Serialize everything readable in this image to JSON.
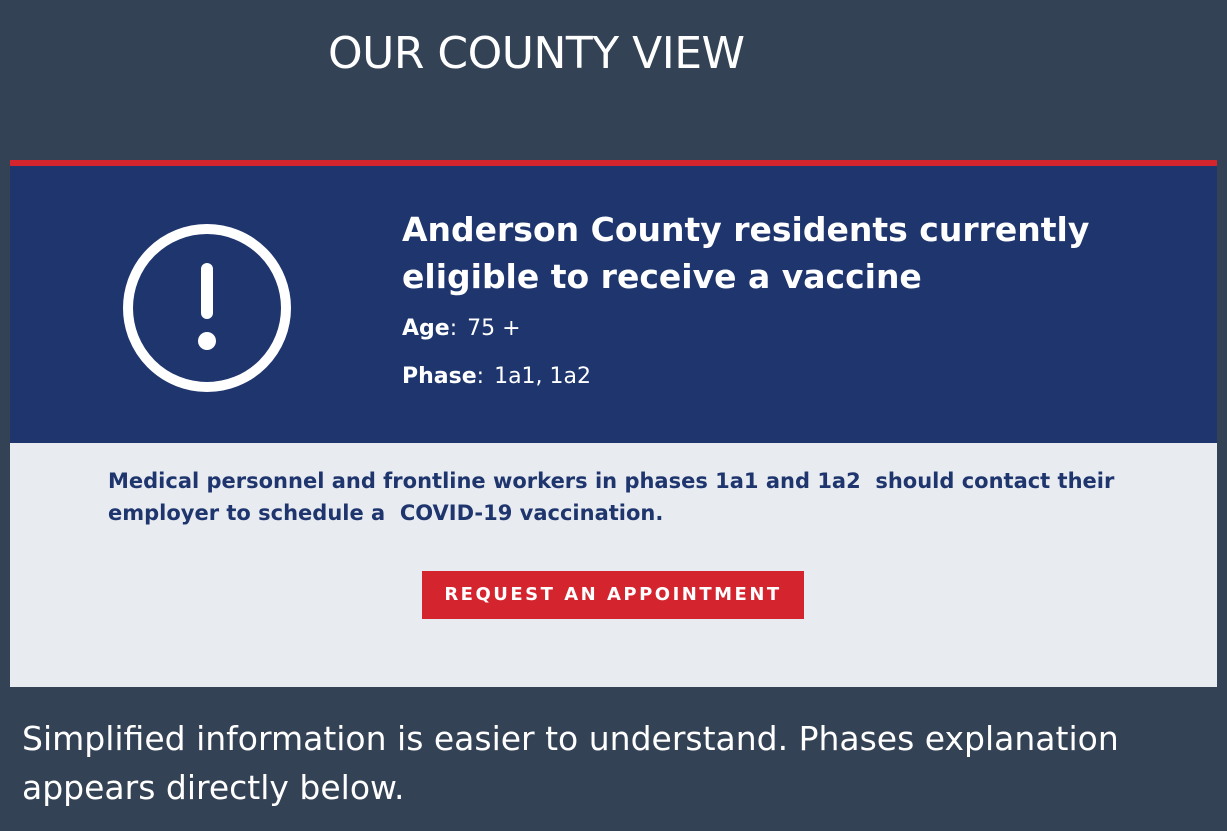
{
  "header": {
    "title": "OUR COUNTY VIEW"
  },
  "card": {
    "heading": "Anderson County residents currently eligible to receive a vaccine",
    "alert_icon": "exclamation-circle-icon",
    "details": [
      {
        "label": "Age",
        "value": "75 +"
      },
      {
        "label": "Phase",
        "value": "1a1, 1a2"
      }
    ],
    "note": "Medical personnel and frontline workers in phases 1a1 and 1a2  should contact their employer to schedule a  COVID-19 vaccination.",
    "button_label": "REQUEST AN APPOINTMENT"
  },
  "caption": "Simplified information is easier to understand. Phases explanation appears directly below.",
  "colors": {
    "background": "#344256",
    "accent": "#d4252f",
    "banner": "#1e356e",
    "body": "#e8ebf0"
  }
}
